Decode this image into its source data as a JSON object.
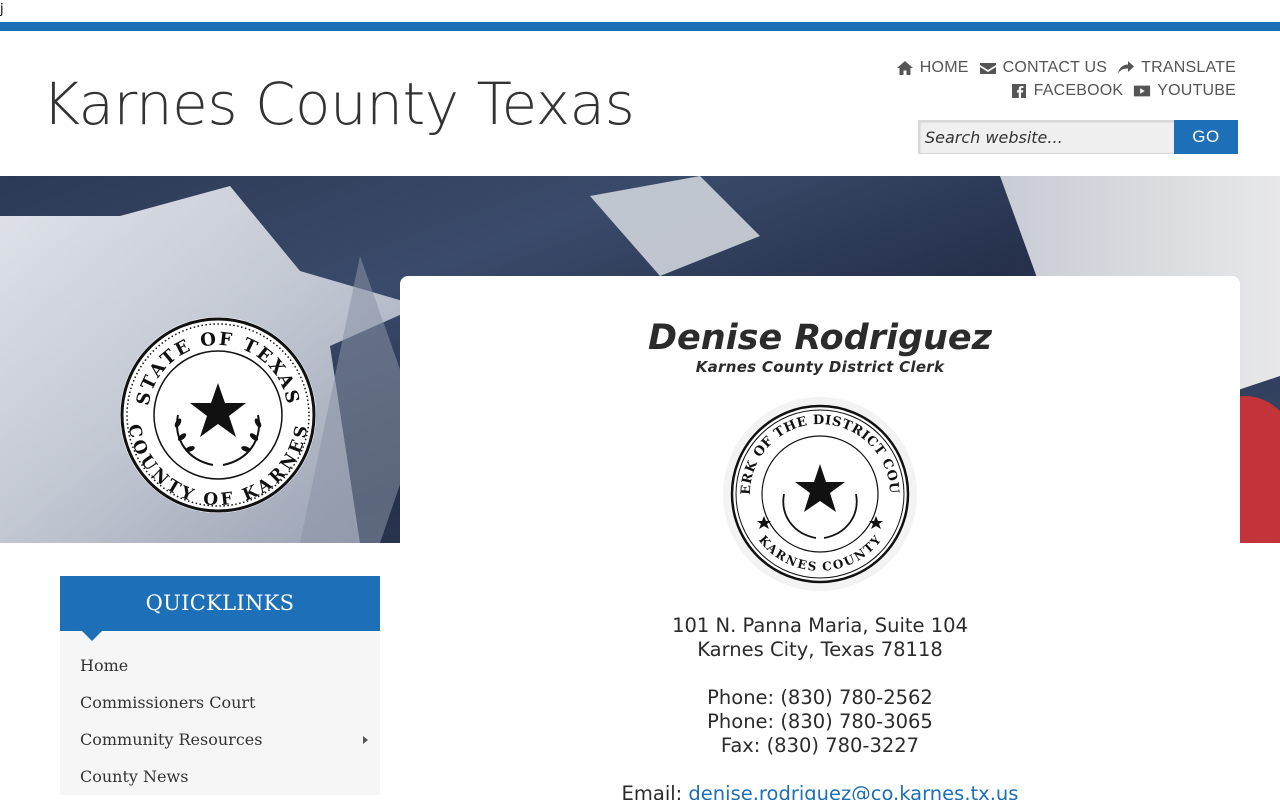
{
  "stray_text": "j",
  "site": {
    "title": "Karnes County Texas"
  },
  "toplinks": {
    "home": "HOME",
    "contact": "CONTACT US",
    "translate": "TRANSLATE",
    "facebook": "FACEBOOK",
    "youtube": "YOUTUBE"
  },
  "search": {
    "placeholder": "Search website...",
    "button": "GO"
  },
  "county_seal": {
    "top_text": "STATE OF TEXAS",
    "bottom_text": "COUNTY OF KARNES"
  },
  "profile": {
    "name": "Denise Rodriguez",
    "role": "Karnes County District Clerk",
    "seal_top": "CLERK OF THE DISTRICT COURT",
    "seal_bottom": "KARNES COUNTY",
    "address_line1": "101 N. Panna Maria, Suite 104",
    "address_line2": "Karnes City, Texas 78118",
    "phone1": "Phone: (830) 780-2562",
    "phone2": "Phone: (830) 780-3065",
    "fax": "Fax: (830) 780-3227",
    "email_label": "Email:",
    "email": "denise.rodriguez@co.karnes.tx.us"
  },
  "quicklinks": {
    "title": "QUICKLINKS",
    "items": [
      {
        "label": "Home"
      },
      {
        "label": "Commissioners Court"
      },
      {
        "label": "Community Resources"
      },
      {
        "label": "County News"
      }
    ]
  },
  "colors": {
    "accent": "#1d6fb8",
    "text": "#333333"
  }
}
